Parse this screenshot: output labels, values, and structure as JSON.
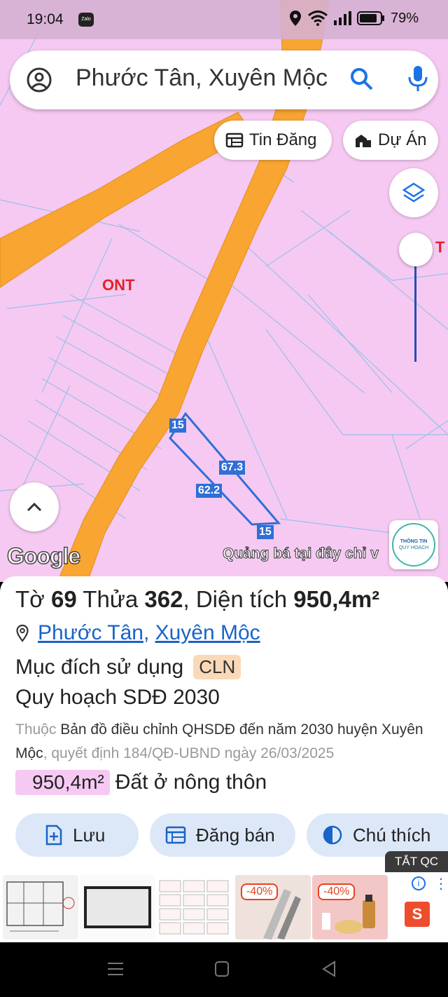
{
  "status_bar": {
    "time": "19:04",
    "app_icon": "Zalo",
    "battery": "79%"
  },
  "search": {
    "query": "Phước Tân, Xuyên Mộc"
  },
  "chips": {
    "tin_dang": "Tin Đăng",
    "du_an": "Dự Án"
  },
  "map": {
    "zone_label": "ONT",
    "edge_label": "T",
    "dims": {
      "top": "15",
      "right": "67.3",
      "left": "62.2",
      "bottom": "15"
    },
    "google": "Google",
    "promo": "Quảng bá tại đây chỉ v",
    "badge_top": "THÔNG TIN",
    "badge_bottom": "QUY HOẠCH"
  },
  "parcel": {
    "to_label": "Tờ",
    "to_value": "69",
    "thua_label": "Thửa",
    "thua_value": "362",
    "area_label": ", Diện tích",
    "area_value": "950,4m²",
    "ward": "Phước Tân",
    "district": "Xuyên Mộc",
    "purpose_label": "Mục đích sử dụng",
    "purpose_code": "CLN",
    "plan": "Quy hoạch SDĐ 2030",
    "desc_prefix": "Thuộc",
    "desc_main": "Bản đồ điều chỉnh QHSDĐ đến năm 2030 huyện Xuyên Mộc",
    "desc_suffix": ", quyết định 184/QĐ-UBND ngày 26/03/2025",
    "zone_area": "950,4m²",
    "zone_name": "Đất ở nông thôn"
  },
  "actions": {
    "save": "Lưu",
    "sell": "Đăng bán",
    "legend": "Chú thích"
  },
  "ads": {
    "close_label": "TẮT QC",
    "discount_1": "-40%",
    "discount_2": "-40%",
    "shop": "S",
    "info": "i",
    "more": "⋮"
  },
  "colors": {
    "road": "#f8a532",
    "zone": "#f6c9f2",
    "parcel_line": "#2f6fd6",
    "accent": "#1a63c7"
  }
}
